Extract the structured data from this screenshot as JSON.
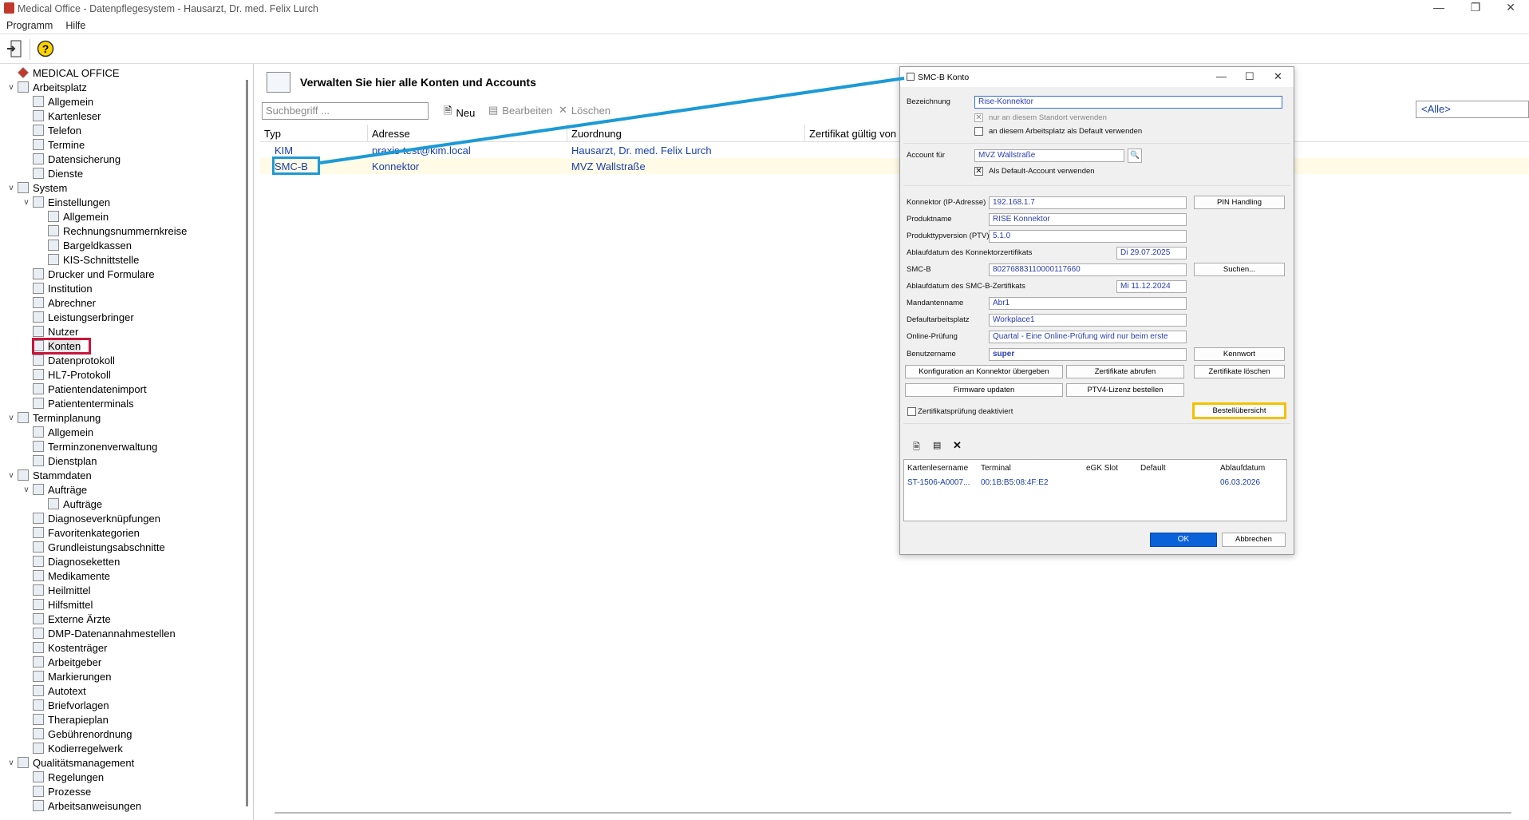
{
  "window": {
    "title": "Medical Office - Datenpflegesystem - Hausarzt, Dr. med. Felix Lurch"
  },
  "menu": [
    "Programm",
    "Hilfe"
  ],
  "tree": [
    {
      "label": "MEDICAL OFFICE",
      "level": 0,
      "tw": "",
      "icon": "medical-office-icon"
    },
    {
      "label": "Arbeitsplatz",
      "level": 0,
      "tw": "v",
      "icon": "computer-icon"
    },
    {
      "label": "Allgemein",
      "level": 1,
      "tw": "",
      "icon": "document-icon"
    },
    {
      "label": "Kartenleser",
      "level": 1,
      "tw": "",
      "icon": "card-reader-icon"
    },
    {
      "label": "Telefon",
      "level": 1,
      "tw": "",
      "icon": "phone-icon"
    },
    {
      "label": "Termine",
      "level": 1,
      "tw": "",
      "icon": "calendar-icon"
    },
    {
      "label": "Datensicherung",
      "level": 1,
      "tw": "",
      "icon": "backup-icon"
    },
    {
      "label": "Dienste",
      "level": 1,
      "tw": "",
      "icon": "gear-icon"
    },
    {
      "label": "System",
      "level": 0,
      "tw": "v",
      "icon": "server-icon"
    },
    {
      "label": "Einstellungen",
      "level": 1,
      "tw": "v",
      "icon": "gears-icon"
    },
    {
      "label": "Allgemein",
      "level": 2,
      "tw": "",
      "icon": "document-icon"
    },
    {
      "label": "Rechnungsnummernkreise",
      "level": 2,
      "tw": "",
      "icon": "number-icon"
    },
    {
      "label": "Bargeldkassen",
      "level": 2,
      "tw": "",
      "icon": "cash-icon"
    },
    {
      "label": "KIS-Schnittstelle",
      "level": 2,
      "tw": "",
      "icon": "interface-icon"
    },
    {
      "label": "Drucker und Formulare",
      "level": 1,
      "tw": "",
      "icon": "printer-icon"
    },
    {
      "label": "Institution",
      "level": 1,
      "tw": "",
      "icon": "institution-icon"
    },
    {
      "label": "Abrechner",
      "level": 1,
      "tw": "",
      "icon": "user-icon"
    },
    {
      "label": "Leistungserbringer",
      "level": 1,
      "tw": "",
      "icon": "user-icon"
    },
    {
      "label": "Nutzer",
      "level": 1,
      "tw": "",
      "icon": "user-icon"
    },
    {
      "label": "Konten",
      "level": 1,
      "tw": "",
      "icon": "accounts-icon"
    },
    {
      "label": "Datenprotokoll",
      "level": 1,
      "tw": "",
      "icon": "log-icon"
    },
    {
      "label": "HL7-Protokoll",
      "level": 1,
      "tw": "",
      "icon": "hl7-icon"
    },
    {
      "label": "Patientendatenimport",
      "level": 1,
      "tw": "",
      "icon": "import-icon"
    },
    {
      "label": "Patiententerminals",
      "level": 1,
      "tw": "",
      "icon": "terminal-icon"
    },
    {
      "label": "Terminplanung",
      "level": 0,
      "tw": "v",
      "icon": "calendar-icon"
    },
    {
      "label": "Allgemein",
      "level": 1,
      "tw": "",
      "icon": "document-icon"
    },
    {
      "label": "Terminzonenverwaltung",
      "level": 1,
      "tw": "",
      "icon": "calendar-icon"
    },
    {
      "label": "Dienstplan",
      "level": 1,
      "tw": "",
      "icon": "calendar-icon"
    },
    {
      "label": "Stammdaten",
      "level": 0,
      "tw": "v",
      "icon": "folder-icon"
    },
    {
      "label": "Aufträge",
      "level": 1,
      "tw": "v",
      "icon": "document-icon"
    },
    {
      "label": "Aufträge",
      "level": 2,
      "tw": "",
      "icon": "document-icon"
    },
    {
      "label": "Diagnoseverknüpfungen",
      "level": 1,
      "tw": "",
      "icon": "diagnosis-icon"
    },
    {
      "label": "Favoritenkategorien",
      "level": 1,
      "tw": "",
      "icon": "document-icon"
    },
    {
      "label": "Grundleistungsabschnitte",
      "level": 1,
      "tw": "",
      "icon": "document-icon"
    },
    {
      "label": "Diagnoseketten",
      "level": 1,
      "tw": "",
      "icon": "chain-icon"
    },
    {
      "label": "Medikamente",
      "level": 1,
      "tw": "",
      "icon": "pill-icon"
    },
    {
      "label": "Heilmittel",
      "level": 1,
      "tw": "",
      "icon": "remedy-icon"
    },
    {
      "label": "Hilfsmittel",
      "level": 1,
      "tw": "",
      "icon": "aid-icon"
    },
    {
      "label": "Externe Ärzte",
      "level": 1,
      "tw": "",
      "icon": "doctor-icon"
    },
    {
      "label": "DMP-Datenannahmestellen",
      "level": 1,
      "tw": "",
      "icon": "institution-icon"
    },
    {
      "label": "Kostenträger",
      "level": 1,
      "tw": "",
      "icon": "payer-icon"
    },
    {
      "label": "Arbeitgeber",
      "level": 1,
      "tw": "",
      "icon": "employer-icon"
    },
    {
      "label": "Markierungen",
      "level": 1,
      "tw": "",
      "icon": "pen-icon"
    },
    {
      "label": "Autotext",
      "level": 1,
      "tw": "",
      "icon": "document-icon"
    },
    {
      "label": "Briefvorlagen",
      "level": 1,
      "tw": "",
      "icon": "letter-icon"
    },
    {
      "label": "Therapieplan",
      "level": 1,
      "tw": "",
      "icon": "stethoscope-icon"
    },
    {
      "label": "Gebührenordnung",
      "level": 1,
      "tw": "",
      "icon": "fee-icon"
    },
    {
      "label": "Kodierregelwerk",
      "level": 1,
      "tw": "",
      "icon": "code-icon"
    },
    {
      "label": "Qualitätsmanagement",
      "level": 0,
      "tw": "v",
      "icon": "qm-icon"
    },
    {
      "label": "Regelungen",
      "level": 1,
      "tw": "",
      "icon": "rule-icon"
    },
    {
      "label": "Prozesse",
      "level": 1,
      "tw": "",
      "icon": "gears-icon"
    },
    {
      "label": "Arbeitsanweisungen",
      "level": 1,
      "tw": "",
      "icon": "document-icon"
    }
  ],
  "main": {
    "heading": "Verwalten Sie hier alle Konten und Accounts",
    "search_placeholder": "Suchbegriff ...",
    "actions": {
      "new": "Neu",
      "edit": "Bearbeiten",
      "delete": "Löschen"
    },
    "filter": "<Alle>",
    "columns": [
      "Typ",
      "Adresse",
      "Zuordnung",
      "Zertifikat gültig von"
    ],
    "rows": [
      [
        "KIM",
        "praxis-test@kim.local",
        "Hausarzt, Dr. med. Felix Lurch",
        ""
      ],
      [
        "SMC-B",
        "Konnektor",
        "MVZ Wallstraße",
        ""
      ]
    ]
  },
  "dialog": {
    "title": "SMC-B Konto",
    "bezeichnung_label": "Bezeichnung",
    "bezeichnung_value": "Rise-Konnektor",
    "cb_standort": "nur an diesem Standort verwenden",
    "cb_default_ap": "an diesem Arbeitsplatz als Default verwenden",
    "account_label": "Account für",
    "account_value": "MVZ Wallstraße",
    "cb_default_account": "Als Default-Account verwenden",
    "fields": [
      {
        "label": "Konnektor (IP-Adresse)",
        "value": "192.168.1.7"
      },
      {
        "label": "Produktname",
        "value": "RISE Konnektor"
      },
      {
        "label": "Produkttypversion (PTV)",
        "value": "5.1.0"
      },
      {
        "label": "Ablaufdatum des Konnektorzertifikats",
        "value": "Di 29.07.2025"
      },
      {
        "label": "SMC-B",
        "value": "80276883110000117660"
      },
      {
        "label": "Ablaufdatum des SMC-B-Zertifikats",
        "value": "Mi 11.12.2024"
      },
      {
        "label": "Mandantenname",
        "value": "Abr1"
      },
      {
        "label": "Defaultarbeitsplatz",
        "value": "Workplace1"
      },
      {
        "label": "Online-Prüfung",
        "value": "Quartal - Eine Online-Prüfung wird nur beim erste"
      },
      {
        "label": "Benutzername",
        "value": "super"
      }
    ],
    "btn_pin": "PIN Handling",
    "btn_suchen": "Suchen...",
    "btn_kennwort": "Kennwort",
    "btn_konfig": "Konfiguration an Konnektor übergeben",
    "btn_zert_abrufen": "Zertifikate abrufen",
    "btn_zert_loeschen": "Zertifikate löschen",
    "btn_firmware": "Firmware updaten",
    "btn_ptv4": "PTV4-Lizenz bestellen",
    "btn_bestell": "Bestellübersicht",
    "cb_zert": "Zertifikatsprüfung deaktiviert",
    "grid_cols": [
      "Kartenlesername",
      "Terminal",
      "eGK Slot",
      "Default",
      "Ablaufdatum"
    ],
    "grid_row": [
      "ST-1506-A0007...",
      "00:1B:B5:08:4F:E2",
      "",
      "",
      "06.03.2026"
    ],
    "ok": "OK",
    "cancel": "Abbrechen"
  },
  "colors": {
    "link": "#1a3fa8",
    "highlight_red": "#c8163c",
    "highlight_blue": "#1c9ad6",
    "highlight_yellow": "#f5c000",
    "ok_blue": "#0a62d8"
  }
}
